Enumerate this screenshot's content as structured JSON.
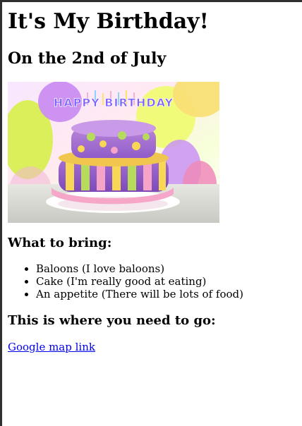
{
  "page": {
    "title": "It's My Birthday!",
    "subtitle": "On the 2nd of July"
  },
  "image": {
    "topper_text": "HAPPY BIRTHDAY"
  },
  "sections": {
    "bring_heading": "What to bring:",
    "items": [
      "Baloons (I love baloons)",
      "Cake (I'm really good at eating)",
      "An appetite (There will be lots of food)"
    ],
    "where_heading": "This is where you need to go:",
    "link_text": "Google map link"
  },
  "colors": {
    "link": "#0000ee",
    "frame": "#2f2f2f"
  }
}
